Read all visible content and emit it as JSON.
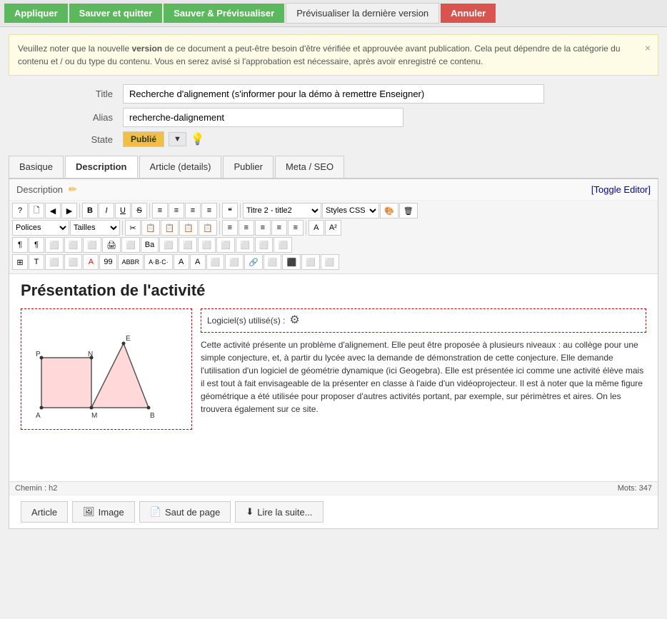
{
  "toolbar": {
    "apply_label": "Appliquer",
    "save_quit_label": "Sauver et quitter",
    "save_preview_label": "Sauver & Prévisualiser",
    "preview_last_label": "Prévisualiser la dernière version",
    "cancel_label": "Annuler"
  },
  "notice": {
    "text_before": "Veuillez noter que la nouvelle ",
    "text_bold": "version",
    "text_after": " de ce document a peut-être besoin d'être vérifiée et approuvée avant publication. Cela peut dépendre de la catégorie du contenu et / ou du type du contenu. Vous en serez avisé si l'approbation est nécessaire, après avoir enregistré ce contenu.",
    "close_label": "×"
  },
  "fields": {
    "title_label": "Title",
    "title_value": "Recherche d'alignement (s'informer pour la démo à remettre Enseigner)",
    "alias_label": "Alias",
    "alias_value": "recherche-dalignement",
    "state_label": "State",
    "state_value": "Publié"
  },
  "tabs": {
    "items": [
      {
        "id": "basique",
        "label": "Basique",
        "active": false
      },
      {
        "id": "description",
        "label": "Description",
        "active": true
      },
      {
        "id": "article-details",
        "label": "Article (details)",
        "active": false
      },
      {
        "id": "publier",
        "label": "Publier",
        "active": false
      },
      {
        "id": "meta-seo",
        "label": "Meta / SEO",
        "active": false
      }
    ]
  },
  "editor": {
    "section_label": "Description",
    "toggle_label": "[Toggle Editor]",
    "rte": {
      "row1": [
        "?",
        "🗋",
        "◀",
        "▶",
        "B",
        "I",
        "U",
        "S",
        "≡",
        "≡",
        "≡",
        "≡",
        "❝",
        "Titre 2 - title2",
        "Styles CSS",
        "🎨",
        "🗑"
      ],
      "row2": [
        "Polices",
        "Tailles",
        "✂",
        "📋",
        "📋",
        "📋",
        "📋",
        "≡",
        "≡",
        "≡",
        "≡",
        "≡",
        "A",
        "A²"
      ],
      "row3": [
        "¶",
        "¶",
        "⬜",
        "⬜",
        "⬜",
        "🖨",
        "⬜",
        "Ba",
        "⬜",
        "⬜",
        "⬜",
        "⬜",
        "⬜",
        "⬜",
        "⬜"
      ],
      "row4": [
        "⬜",
        "T",
        "⬜",
        "⬜",
        "A",
        "99",
        "ABBR",
        "A·B·C·",
        "A",
        "A",
        "⬜",
        "⬓",
        "⬜",
        "⬜",
        "⬜",
        "⬜",
        "⬜"
      ]
    },
    "content": {
      "heading": "Présentation de l'activité",
      "logiciel_label": "Logiciel(s) utilisé(s) :",
      "main_text": "Cette activité présente un problème d'alignement. Elle peut être proposée à plusieurs niveaux : au collège pour une simple conjecture, et, à partir du lycée avec la demande de démonstration de cette conjecture. Elle demande l'utilisation d'un logiciel de géométrie dynamique (ici Geogebra). Elle est présentée ici comme une activité élève mais il est tout à fait envisageable de la présenter en classe à l'aide d'un vidéoprojecteur. Il est à noter que la même figure géométrique a été utilisée pour proposer d'autres activités portant, par exemple, sur périmètres et aires. On les trouvera également sur ce site."
    },
    "statusbar": {
      "chemin": "Chemin : h2",
      "mots": "Mots: 347"
    }
  },
  "bottom_buttons": [
    {
      "id": "article",
      "label": "Article",
      "icon": ""
    },
    {
      "id": "image",
      "label": "Image",
      "icon": "🖼"
    },
    {
      "id": "saut-de-page",
      "label": "Saut de page",
      "icon": "📄"
    },
    {
      "id": "lire-la-suite",
      "label": "Lire la suite...",
      "icon": "⬇"
    }
  ]
}
